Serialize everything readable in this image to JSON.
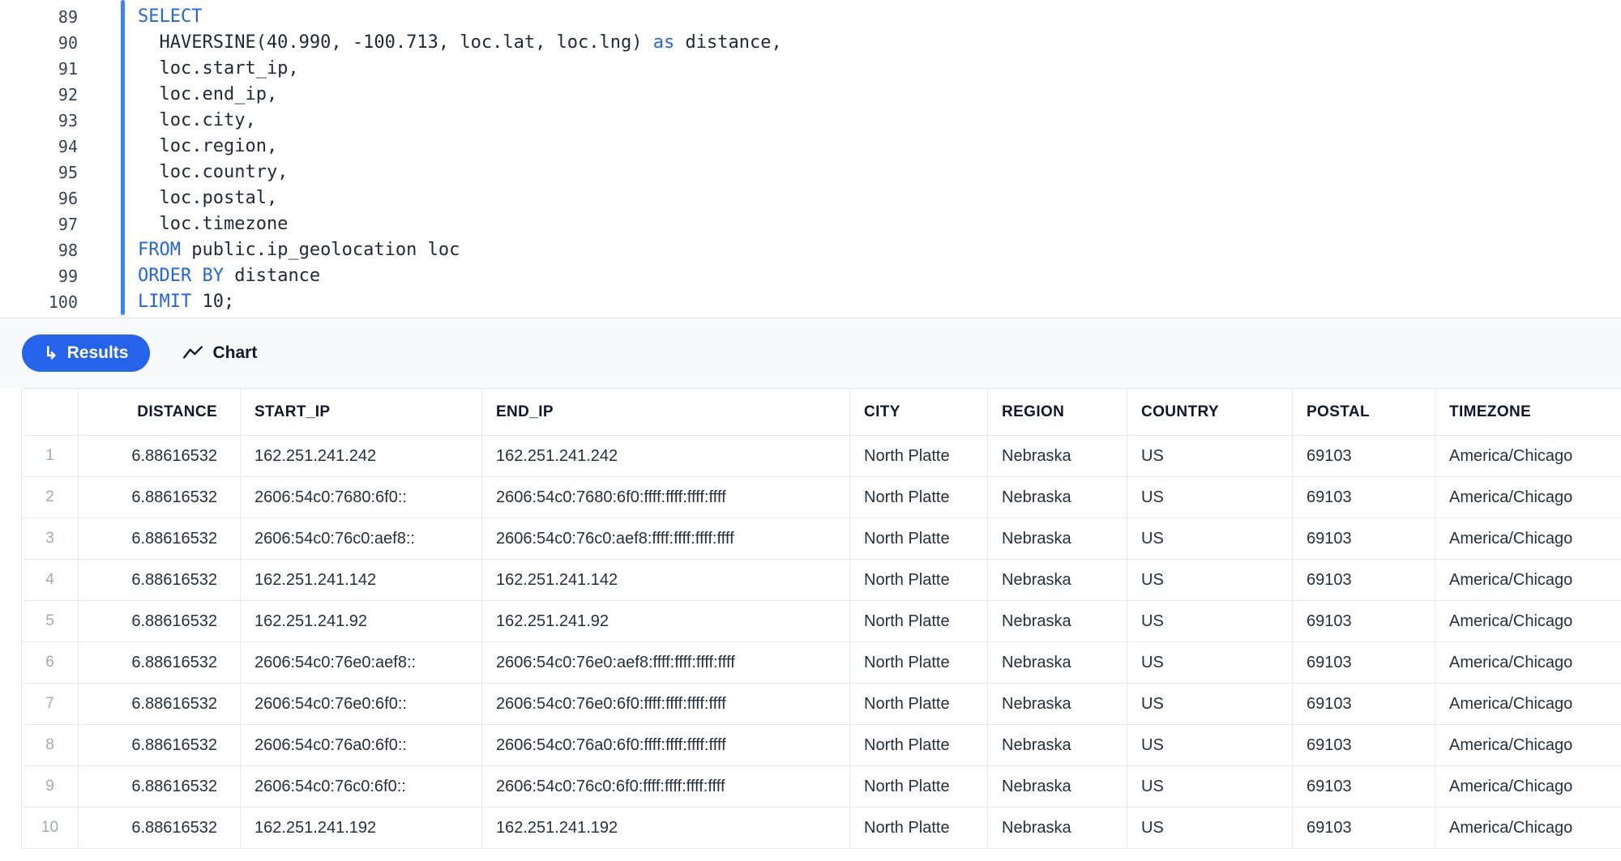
{
  "editor": {
    "lines": [
      {
        "number": "89",
        "segments": [
          {
            "type": "keyword",
            "text": "SELECT"
          }
        ]
      },
      {
        "number": "90",
        "segments": [
          {
            "type": "plain",
            "text": "  HAVERSINE(40.990, -100.713, loc.lat, loc.lng) "
          },
          {
            "type": "keyword",
            "text": "as"
          },
          {
            "type": "plain",
            "text": " distance,"
          }
        ]
      },
      {
        "number": "91",
        "segments": [
          {
            "type": "plain",
            "text": "  loc.start_ip,"
          }
        ]
      },
      {
        "number": "92",
        "segments": [
          {
            "type": "plain",
            "text": "  loc.end_ip,"
          }
        ]
      },
      {
        "number": "93",
        "segments": [
          {
            "type": "plain",
            "text": "  loc.city,"
          }
        ]
      },
      {
        "number": "94",
        "segments": [
          {
            "type": "plain",
            "text": "  loc.region,"
          }
        ]
      },
      {
        "number": "95",
        "segments": [
          {
            "type": "plain",
            "text": "  loc.country,"
          }
        ]
      },
      {
        "number": "96",
        "segments": [
          {
            "type": "plain",
            "text": "  loc.postal,"
          }
        ]
      },
      {
        "number": "97",
        "segments": [
          {
            "type": "plain",
            "text": "  loc.timezone"
          }
        ]
      },
      {
        "number": "98",
        "segments": [
          {
            "type": "keyword",
            "text": "FROM"
          },
          {
            "type": "plain",
            "text": " public.ip_geolocation loc"
          }
        ]
      },
      {
        "number": "99",
        "segments": [
          {
            "type": "keyword",
            "text": "ORDER BY"
          },
          {
            "type": "plain",
            "text": " distance"
          }
        ]
      },
      {
        "number": "100",
        "segments": [
          {
            "type": "keyword",
            "text": "LIMIT"
          },
          {
            "type": "plain",
            "text": " 10;"
          }
        ]
      }
    ]
  },
  "tabs": {
    "results_label": "Results",
    "results_icon": "↳",
    "chart_label": "Chart"
  },
  "table": {
    "columns": [
      {
        "key": "rownum",
        "label": ""
      },
      {
        "key": "distance",
        "label": "DISTANCE"
      },
      {
        "key": "start_ip",
        "label": "START_IP"
      },
      {
        "key": "end_ip",
        "label": "END_IP"
      },
      {
        "key": "city",
        "label": "CITY"
      },
      {
        "key": "region",
        "label": "REGION"
      },
      {
        "key": "country",
        "label": "COUNTRY"
      },
      {
        "key": "postal",
        "label": "POSTAL"
      },
      {
        "key": "timezone",
        "label": "TIMEZONE"
      }
    ],
    "rows": [
      [
        "1",
        "6.88616532",
        "162.251.241.242",
        "162.251.241.242",
        "North Platte",
        "Nebraska",
        "US",
        "69103",
        "America/Chicago"
      ],
      [
        "2",
        "6.88616532",
        "2606:54c0:7680:6f0::",
        "2606:54c0:7680:6f0:ffff:ffff:ffff:ffff",
        "North Platte",
        "Nebraska",
        "US",
        "69103",
        "America/Chicago"
      ],
      [
        "3",
        "6.88616532",
        "2606:54c0:76c0:aef8::",
        "2606:54c0:76c0:aef8:ffff:ffff:ffff:ffff",
        "North Platte",
        "Nebraska",
        "US",
        "69103",
        "America/Chicago"
      ],
      [
        "4",
        "6.88616532",
        "162.251.241.142",
        "162.251.241.142",
        "North Platte",
        "Nebraska",
        "US",
        "69103",
        "America/Chicago"
      ],
      [
        "5",
        "6.88616532",
        "162.251.241.92",
        "162.251.241.92",
        "North Platte",
        "Nebraska",
        "US",
        "69103",
        "America/Chicago"
      ],
      [
        "6",
        "6.88616532",
        "2606:54c0:76e0:aef8::",
        "2606:54c0:76e0:aef8:ffff:ffff:ffff:ffff",
        "North Platte",
        "Nebraska",
        "US",
        "69103",
        "America/Chicago"
      ],
      [
        "7",
        "6.88616532",
        "2606:54c0:76e0:6f0::",
        "2606:54c0:76e0:6f0:ffff:ffff:ffff:ffff",
        "North Platte",
        "Nebraska",
        "US",
        "69103",
        "America/Chicago"
      ],
      [
        "8",
        "6.88616532",
        "2606:54c0:76a0:6f0::",
        "2606:54c0:76a0:6f0:ffff:ffff:ffff:ffff",
        "North Platte",
        "Nebraska",
        "US",
        "69103",
        "America/Chicago"
      ],
      [
        "9",
        "6.88616532",
        "2606:54c0:76c0:6f0::",
        "2606:54c0:76c0:6f0:ffff:ffff:ffff:ffff",
        "North Platte",
        "Nebraska",
        "US",
        "69103",
        "America/Chicago"
      ],
      [
        "10",
        "6.88616532",
        "162.251.241.192",
        "162.251.241.192",
        "North Platte",
        "Nebraska",
        "US",
        "69103",
        "America/Chicago"
      ]
    ]
  },
  "colors": {
    "accent_blue": "#2563eb",
    "keyword_blue": "#2563eb",
    "selection_bar_blue": "#3b82f6"
  }
}
